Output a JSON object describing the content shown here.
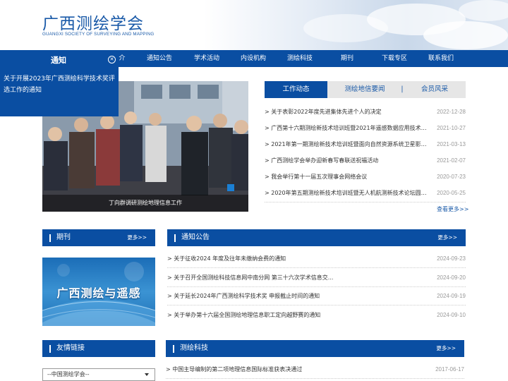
{
  "brand": {
    "name_cn": "广西测绘学会",
    "name_en": "GUANGXI SOCIETY OF SURVEYING AND MAPPING",
    "primary_color": "#0a4ea2"
  },
  "nav": {
    "items": [
      "介",
      "通知公告",
      "学术活动",
      "内设机构",
      "测绘科技",
      "期刊",
      "下载专区",
      "联系我们"
    ]
  },
  "notice": {
    "title": "通知",
    "text": "关于开展2023年广西测绘科学技术奖评选工作的通知"
  },
  "photo": {
    "caption": "丁向群调研测绘地理信息工作"
  },
  "tabs": {
    "items": [
      "工作动态",
      "测绘地信要闻",
      "会员风采"
    ],
    "active": "工作动态",
    "divider": "|"
  },
  "news": [
    {
      "title": "关于表彰2022年度先进集体先进个人的决定",
      "date": "2022-12-28"
    },
    {
      "title": "广西第十六期测绘新技术培训班暨2021年遥感数据应用技术创...",
      "date": "2021-10-27"
    },
    {
      "title": "2021年第一期测绘新技术培训班暨面向自然资源系统卫星影像...",
      "date": "2021-03-13"
    },
    {
      "title": "广西测绘学会举办迎新春写春联送祝福活动",
      "date": "2021-02-07"
    },
    {
      "title": "我会举行第十一届五次理事会网络会议",
      "date": "2020-07-23"
    },
    {
      "title": "2020年第五期测绘新技术培训班暨无人机航测新技术论坛圆满...",
      "date": "2020-05-25"
    }
  ],
  "news_more": "查看更多>>",
  "journal": {
    "title": "期刊",
    "more": "更多>>",
    "banner_text": "广西测绘与遥感"
  },
  "notices": {
    "title": "通知公告",
    "more": "更多>>",
    "items": [
      {
        "title": "关于征收2024 年度及往年未缴纳会费的通知",
        "date": "2024-09-23"
      },
      {
        "title": "关于召开全国测绘科技信息网中南分网 第三十六次学术信息交...",
        "date": "2024-09-20"
      },
      {
        "title": "关于延长2024年广西测绘科学技术奖 申报截止时间的通知",
        "date": "2024-09-19"
      },
      {
        "title": "关于举办第十六届全国测绘地理信息职工定向越野赛的通知",
        "date": "2024-09-10"
      }
    ]
  },
  "links": {
    "title": "友情链接",
    "select_value": "--中国测绘学会--"
  },
  "tech": {
    "title": "测绘科技",
    "more": "更多>>",
    "items": [
      {
        "title": "中国主导编制的第二项地理信息国际标准获表决通过",
        "date": "2017-06-17"
      }
    ]
  }
}
